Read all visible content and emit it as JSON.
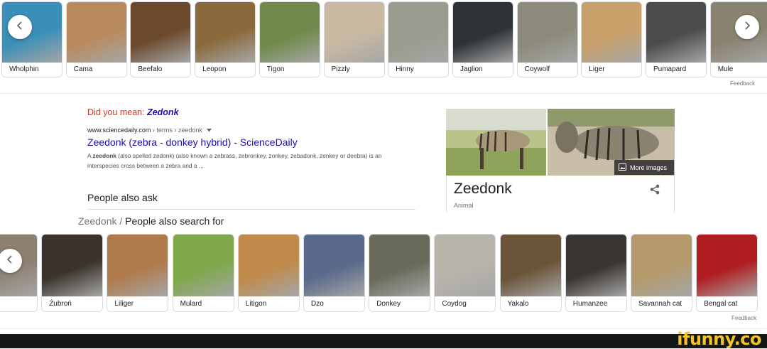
{
  "top_carousel": {
    "prev_icon": "chevron-left-icon",
    "next_icon": "chevron-right-icon",
    "items": [
      {
        "label": "Wholphin",
        "color": "#3a8fb8"
      },
      {
        "label": "Cama",
        "color": "#b98a5c"
      },
      {
        "label": "Beefalo",
        "color": "#6b4a2e"
      },
      {
        "label": "Leopon",
        "color": "#8a6a3c"
      },
      {
        "label": "Tigon",
        "color": "#6f8a4a"
      },
      {
        "label": "Pizzly",
        "color": "#c9b9a3"
      },
      {
        "label": "Hinny",
        "color": "#9a9a8e"
      },
      {
        "label": "Jaglion",
        "color": "#2e3336"
      },
      {
        "label": "Coywolf",
        "color": "#8c8a7a"
      },
      {
        "label": "Liger",
        "color": "#c9a06a"
      },
      {
        "label": "Pumapard",
        "color": "#4c4c4c"
      },
      {
        "label": "Mule",
        "color": "#8a8370"
      }
    ],
    "feedback": "Feedback"
  },
  "search": {
    "did_you_mean_prefix": "Did you mean: ",
    "did_you_mean_term": "Zedonk",
    "cite_domain": "www.sciencedaily.com",
    "cite_path": " › terms › zeedonk",
    "cite_menu_icon": "caret-down-icon",
    "result_title": "Zeedonk (zebra - donkey hybrid) - ScienceDaily",
    "snippet_pre": "A ",
    "snippet_bold": "zeedonk",
    "snippet_post": " (also spelled zedonk) (also known a zebrass, zebronkey, zonkey, zebadonk, zenkey or deebra) is an interspecies cross between a zebra and a ...",
    "people_also_ask": "People also ask",
    "pasf_entity": "Zeedonk",
    "pasf_sep": " / ",
    "pasf_label": "People also search for"
  },
  "knowledge_panel": {
    "title": "Zeedonk",
    "subtitle": "Animal",
    "more_images": "More images",
    "share_icon": "share-icon",
    "image_colors": [
      "#9a8c6a",
      "#a89a80"
    ]
  },
  "bottom_carousel": {
    "prev_icon": "chevron-left-icon",
    "items": [
      {
        "label": "",
        "color": "#8c8070"
      },
      {
        "label": "Żubroń",
        "color": "#3a342c"
      },
      {
        "label": "Liliger",
        "color": "#b07a4a"
      },
      {
        "label": "Mulard",
        "color": "#7ea84a"
      },
      {
        "label": "Litigon",
        "color": "#c08a4a"
      },
      {
        "label": "Dzo",
        "color": "#5a6a8a"
      },
      {
        "label": "Donkey",
        "color": "#6a6a5a"
      },
      {
        "label": "Coydog",
        "color": "#b8b4ac"
      },
      {
        "label": "Yakalo",
        "color": "#6a5438"
      },
      {
        "label": "Humanzee",
        "color": "#3a3530"
      },
      {
        "label": "Savannah cat",
        "color": "#b49a6a"
      },
      {
        "label": "Bengal cat",
        "color": "#b01e22"
      }
    ],
    "feedback": "Feedback"
  },
  "watermark": "ifunny.co"
}
